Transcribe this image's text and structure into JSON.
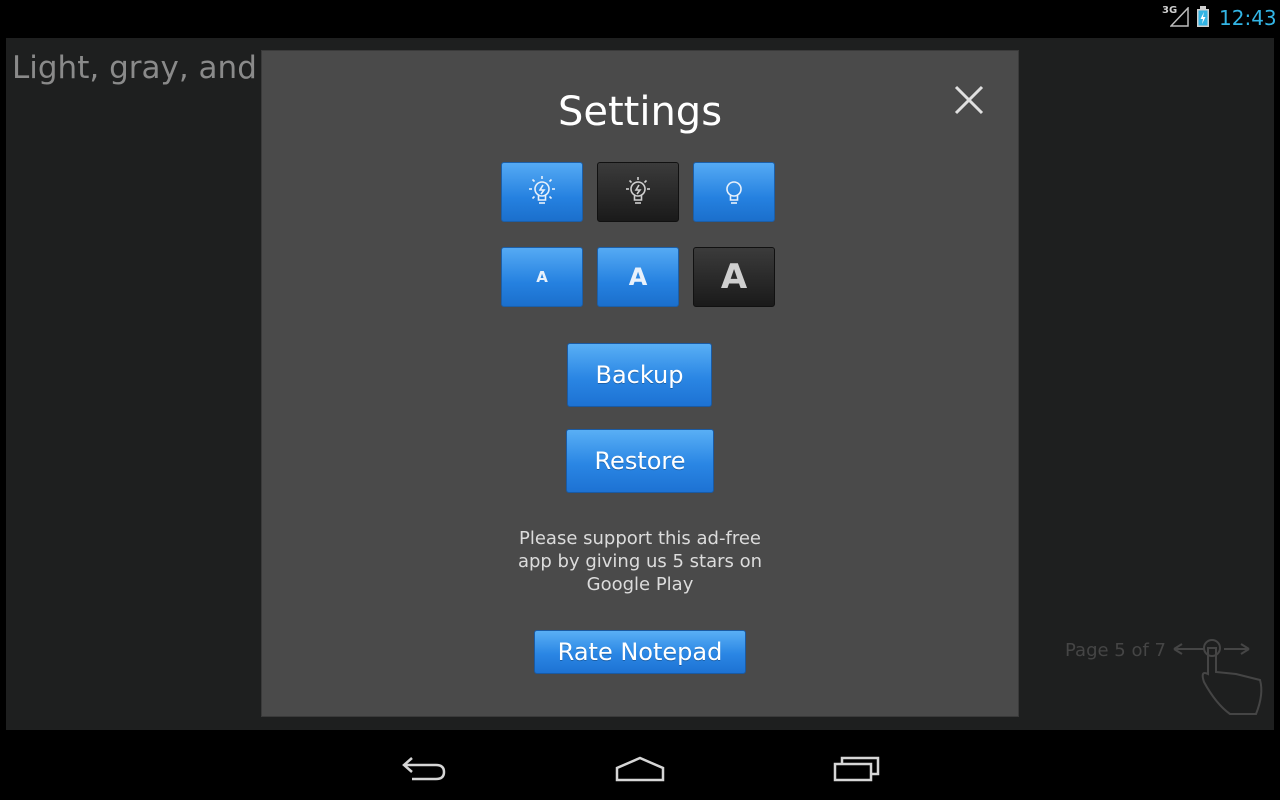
{
  "status_bar": {
    "network": "3G",
    "time": "12:43",
    "signal_icon": "signal-icon",
    "battery_icon": "battery-charging-icon",
    "accent_color": "#33b5e5"
  },
  "note": {
    "text": "Light, gray, and da",
    "page_indicator": "Page 5 of 7"
  },
  "dialog": {
    "title": "Settings",
    "close_icon": "close-icon",
    "theme_buttons": [
      {
        "name": "light-theme",
        "icon": "bright-bulb-icon",
        "selected": false
      },
      {
        "name": "gray-theme",
        "icon": "dim-bulb-icon",
        "selected": true
      },
      {
        "name": "dark-theme",
        "icon": "bulb-icon",
        "selected": false
      }
    ],
    "font_size_buttons": [
      {
        "name": "small-font",
        "label": "A",
        "selected": false
      },
      {
        "name": "medium-font",
        "label": "A",
        "selected": false
      },
      {
        "name": "large-font",
        "label": "A",
        "selected": true
      }
    ],
    "backup_label": "Backup",
    "restore_label": "Restore",
    "support_text": "Please support this ad-free app by giving us 5 stars on Google Play",
    "rate_label": "Rate Notepad"
  },
  "nav_bar": {
    "back_icon": "back-icon",
    "home_icon": "home-icon",
    "recents_icon": "recent-apps-icon"
  },
  "colors": {
    "button_blue": "#2a86e4",
    "dialog_bg": "#4a4a4a",
    "selected_dark": "#1a1a1a"
  }
}
